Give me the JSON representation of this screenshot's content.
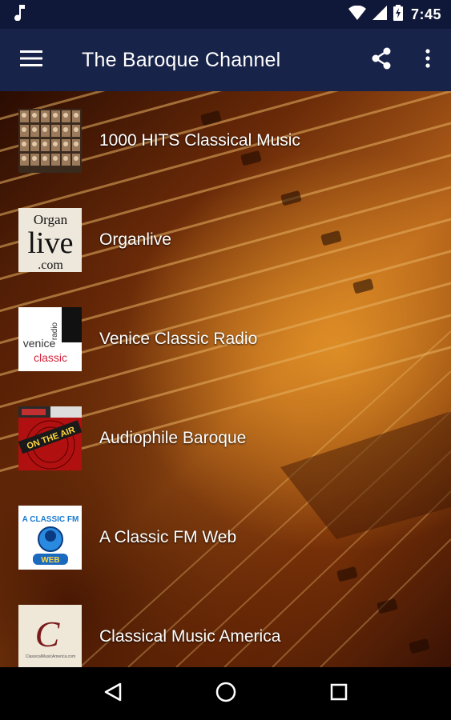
{
  "status_bar": {
    "time": "7:45",
    "icons": [
      "music-note-icon",
      "wifi-icon",
      "cell-signal-icon",
      "battery-charging-icon"
    ]
  },
  "app_bar": {
    "title": "The Baroque Channel",
    "icons": [
      "menu-icon",
      "share-icon",
      "more-vert-icon"
    ]
  },
  "stations": [
    {
      "name": "1000 HITS Classical Music",
      "logo": "composer-portraits-logo"
    },
    {
      "name": "Organlive",
      "logo": "organlive-logo",
      "logo_text": [
        "Organ",
        "live",
        ".com"
      ]
    },
    {
      "name": "Venice Classic Radio",
      "logo": "venice-classic-logo",
      "logo_text": [
        "radio",
        "venice",
        "classic"
      ]
    },
    {
      "name": "Audiophile Baroque",
      "logo": "audiophile-logo",
      "logo_text": [
        "ON THE AIR"
      ]
    },
    {
      "name": "A Classic FM Web",
      "logo": "classic-fm-web-logo",
      "logo_text": [
        "A CLASSIC FM",
        "WEB"
      ]
    },
    {
      "name": "Classical Music America",
      "logo": "classical-music-america-logo",
      "logo_text": [
        "C",
        "ClassicalMusicAmerica.com"
      ]
    }
  ],
  "nav_bar": {
    "icons": [
      "back-icon",
      "home-icon",
      "recents-icon"
    ]
  },
  "colors": {
    "status_bar": "#0f1838",
    "app_bar": "#172348",
    "text": "#ffffff"
  }
}
